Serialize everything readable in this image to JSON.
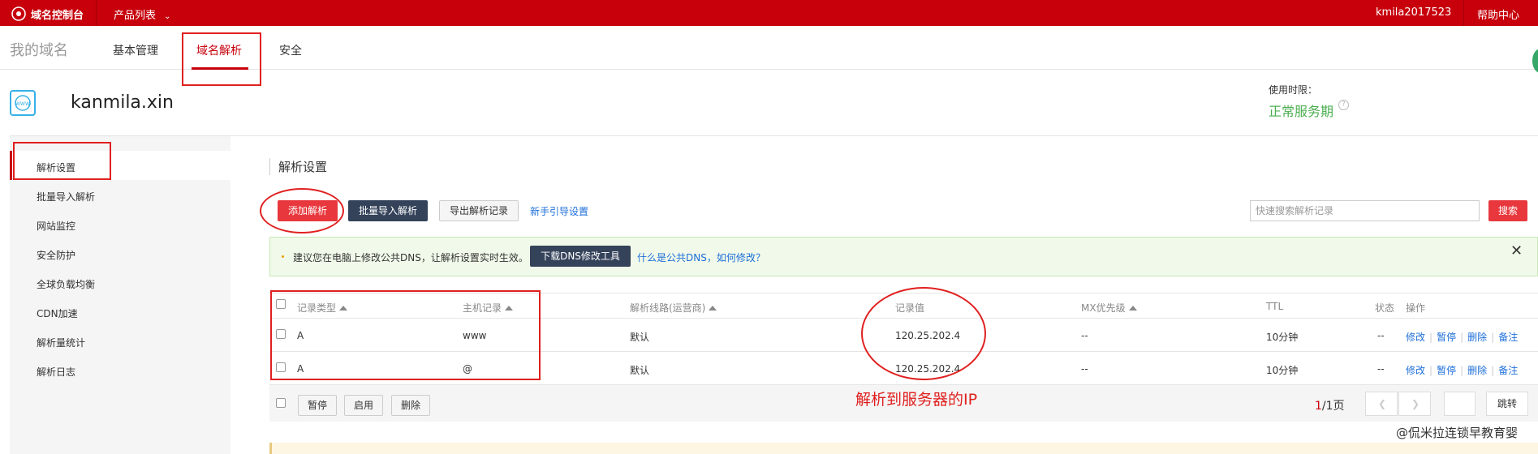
{
  "topbar": {
    "brand": "域名控制台",
    "products": "产品列表",
    "user": "kmila2017523",
    "help": "帮助中心"
  },
  "subnav": {
    "mydomain": "我的域名",
    "tabs": [
      {
        "label": "基本管理"
      },
      {
        "label": "域名解析"
      },
      {
        "label": "安全"
      }
    ]
  },
  "domain": {
    "icon": "www-globe-icon",
    "name": "kanmila.xin",
    "use_label": "使用时限：",
    "use_status": "正常服务期",
    "use_status_color": "#4caf50"
  },
  "sidebar": {
    "items": [
      {
        "label": "解析设置"
      },
      {
        "label": "批量导入解析"
      },
      {
        "label": "网站监控"
      },
      {
        "label": "安全防护"
      },
      {
        "label": "全球负载均衡"
      },
      {
        "label": "CDN加速"
      },
      {
        "label": "解析量统计"
      },
      {
        "label": "解析日志"
      }
    ]
  },
  "main": {
    "title": "解析设置",
    "toolbar": {
      "add": "添加解析",
      "batch_import": "批量导入解析",
      "export": "导出解析记录",
      "guide": "新手引导设置",
      "search_placeholder": "快速搜索解析记录",
      "search": "搜索"
    },
    "alert": {
      "message": "建议您在电脑上修改公共DNS，让解析设置实时生效。",
      "download": "下载DNS修改工具",
      "what": "什么是公共DNS，如何修改？"
    },
    "table": {
      "headers": {
        "type": "记录类型",
        "host": "主机记录",
        "line": "解析线路(运营商)",
        "value": "记录值",
        "mx": "MX优先级",
        "ttl": "TTL",
        "status": "状态",
        "ops": "操作"
      },
      "rows": [
        {
          "type": "A",
          "host": "www",
          "line": "默认",
          "value": "120.25.202.4",
          "mx": "--",
          "ttl": "10分钟",
          "status": "--"
        },
        {
          "type": "A",
          "host": "@",
          "line": "默认",
          "value": "120.25.202.4",
          "mx": "--",
          "ttl": "10分钟",
          "status": "--"
        }
      ],
      "ops": {
        "edit": "修改",
        "pause": "暂停",
        "delete": "删除",
        "note": "备注"
      }
    },
    "footer": {
      "pause": "暂停",
      "enable": "启用",
      "delete": "删除",
      "page_current": "1",
      "page_total": "/1页",
      "jump": "跳转"
    },
    "annotation": "解析到服务器的IP"
  },
  "watermark": "@侃米拉连锁早教育婴",
  "colors": {
    "brand_red": "#c7000b",
    "button_red": "#e8383d",
    "dark_button": "#34425a",
    "link": "#1e6fd9"
  }
}
